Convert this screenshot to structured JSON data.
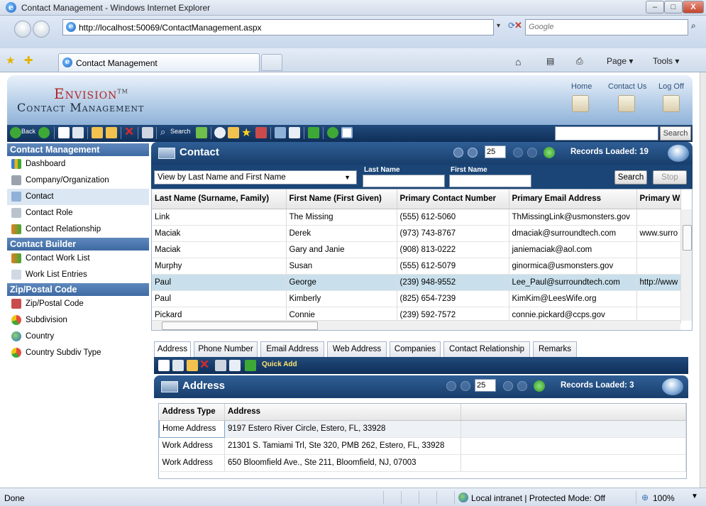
{
  "window": {
    "title": "Contact Management - Windows Internet Explorer",
    "minimize": "–",
    "maximize": "□",
    "close": "X"
  },
  "address_bar": {
    "url": "http://localhost:50069/ContactManagement.aspx",
    "search_placeholder": "Google"
  },
  "browser_tab": {
    "label": "Contact Management"
  },
  "browser_tools": {
    "page": "Page ▾",
    "tools": "Tools ▾"
  },
  "app": {
    "logo_line1": "Envision",
    "logo_tm": "TM",
    "logo_line2": "Contact Management",
    "top_links": [
      "Home",
      "Contact Us",
      "Log Off"
    ],
    "toolbar": {
      "back": "Back",
      "search_label": "Search",
      "search_button": "Search"
    }
  },
  "sidebar": {
    "sections": [
      {
        "title": "Contact Management",
        "items": [
          "Dashboard",
          "Company/Organization",
          "Contact",
          "Contact Role",
          "Contact Relationship"
        ]
      },
      {
        "title": "Contact Builder",
        "items": [
          "Contact Work List",
          "Work List Entries"
        ]
      },
      {
        "title": "Zip/Postal Code",
        "items": [
          "Zip/Postal Code",
          "Subdivision",
          "Country",
          "Country Subdiv Type"
        ]
      }
    ],
    "selected": "Contact"
  },
  "contact_panel": {
    "title": "Contact",
    "page_size": "25",
    "records_loaded": "Records Loaded: 19",
    "view_select": "View by Last Name and First Name",
    "label_last": "Last Name",
    "label_first": "First Name",
    "search_button": "Search",
    "stop_button": "Stop",
    "columns": [
      "Last Name (Surname, Family)",
      "First Name (First Given)",
      "Primary Contact Number",
      "Primary Email Address",
      "Primary W"
    ],
    "rows": [
      [
        "Link",
        "The Missing",
        "(555) 612-5060",
        "ThMissingLink@usmonsters.gov",
        ""
      ],
      [
        "Maciak",
        "Derek",
        "(973) 743-8767",
        "dmaciak@surroundtech.com",
        "www.surro"
      ],
      [
        "Maciak",
        "Gary and Janie",
        "(908) 813-0222",
        "janiemaciak@aol.com",
        ""
      ],
      [
        "Murphy",
        "Susan",
        "(555) 612-5079",
        "ginormica@usmonsters.gov",
        ""
      ],
      [
        "Paul",
        "George",
        "(239) 948-9552",
        "Lee_Paul@surroundtech.com",
        "http://www"
      ],
      [
        "Paul",
        "Kimberly",
        "(825) 654-7239",
        "KimKim@LeesWife.org",
        ""
      ],
      [
        "Pickard",
        "Connie",
        "(239) 592-7572",
        "connie.pickard@ccps.gov",
        ""
      ]
    ],
    "selected_row": 4
  },
  "tabs": [
    "Address",
    "Phone Number",
    "Email Address",
    "Web Address",
    "Companies",
    "Contact Relationship",
    "Remarks"
  ],
  "address_panel": {
    "quick_add": "Quick Add",
    "title": "Address",
    "page_size": "25",
    "records_loaded": "Records Loaded: 3",
    "columns": [
      "Address Type",
      "Address"
    ],
    "rows": [
      [
        "Home Address",
        "9197 Estero River Circle, Estero, FL, 33928"
      ],
      [
        "Work Address",
        "21301 S. Tamiami Trl, Ste 320, PMB 262, Estero, FL, 33928"
      ],
      [
        "Work Address",
        "650 Bloomfield Ave., Ste 211, Bloomfield, NJ, 07003"
      ]
    ]
  },
  "status": {
    "done": "Done",
    "zone": "Local intranet | Protected Mode: Off",
    "zoom": "100%"
  }
}
